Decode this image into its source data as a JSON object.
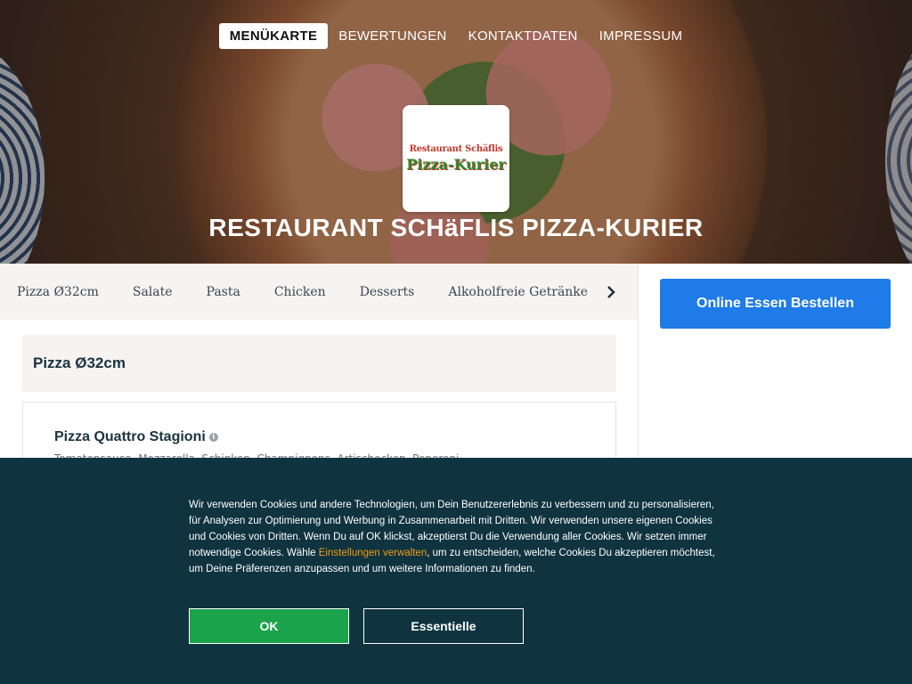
{
  "nav": {
    "items": [
      {
        "label": "MENÜKARTE",
        "active": true
      },
      {
        "label": "BEWERTUNGEN",
        "active": false
      },
      {
        "label": "KONTAKTDATEN",
        "active": false
      },
      {
        "label": "IMPRESSUM",
        "active": false
      }
    ]
  },
  "logo": {
    "line1": "Restaurant Schäflis",
    "line2": "Pizza-Kurier"
  },
  "restaurant": {
    "name": "RESTAURANT SCHäFLIS PIZZA-KURIER"
  },
  "categories": {
    "items": [
      "Pizza Ø32cm",
      "Salate",
      "Pasta",
      "Chicken",
      "Desserts",
      "Alkoholfreie Getränke"
    ],
    "more_icon": "chevron-right-icon"
  },
  "sidebar": {
    "order_button": "Online Essen Bestellen",
    "accent": "#1e7be8"
  },
  "menu": {
    "section_title": "Pizza Ø32cm",
    "item": {
      "name": "Pizza Quattro Stagioni",
      "info_icon": "info-icon",
      "description": "Tomatensauce, Mozzarella, Schinken, Champignons, Artischocken, Peperoni"
    }
  },
  "cookie": {
    "text_before_link": "Wir verwenden Cookies und andere Technologien, um Dein Benutzererlebnis zu verbessern und zu personalisieren, für Analysen zur Optimierung und Werbung in Zusammenarbeit mit Dritten. Wir verwenden unsere eigenen Cookies und Cookies von Dritten. Wenn Du auf OK klickst, akzeptierst Du die Verwendung aller Cookies. Wir setzen immer notwendige Cookies. Wähle ",
    "link": "Einstellungen verwalten",
    "text_after_link": ", um zu entscheiden, welche Cookies Du akzeptieren möchtest, um Deine Präferenzen anzupassen und um weitere Informationen zu finden.",
    "ok_label": "OK",
    "essential_label": "Essentielle",
    "colors": {
      "background": "#0f3440",
      "ok": "#1aa34a",
      "link": "#f39c12"
    }
  }
}
